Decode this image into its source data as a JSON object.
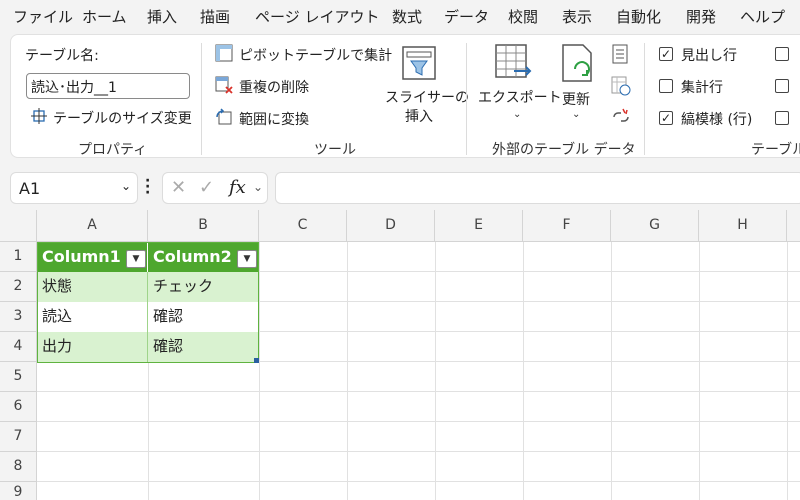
{
  "menu": [
    "ファイル",
    "ホーム",
    "挿入",
    "描画",
    "ページ レイアウト",
    "数式",
    "データ",
    "校閲",
    "表示",
    "自動化",
    "開発",
    "ヘルプ"
  ],
  "ribbon": {
    "properties": {
      "name_label": "テーブル名:",
      "name_value": "読込･出力__1",
      "resize_label": "テーブルのサイズ変更",
      "group_label": "プロパティ"
    },
    "tools": {
      "pivot_label": "ピボットテーブルで集計",
      "dedupe_label": "重複の削除",
      "convert_label": "範囲に変換",
      "slicer_label_1": "スライサーの",
      "slicer_label_2": "挿入",
      "group_label": "ツール"
    },
    "external": {
      "export_label": "エクスポート",
      "refresh_label": "更新",
      "group_label": "外部のテーブル データ"
    },
    "style_options": {
      "header_row": {
        "label": "見出し行",
        "checked": "✓"
      },
      "total_row": {
        "label": "集計行",
        "checked": ""
      },
      "banded_rows": {
        "label": "縞模様 (行)",
        "checked": "✓"
      },
      "group_label": "テーブル"
    }
  },
  "formula_bar": {
    "cell_ref": "A1",
    "fx": "fx",
    "cancel": "✕",
    "enter": "✓",
    "value": ""
  },
  "sheet": {
    "columns": [
      "A",
      "B",
      "C",
      "D",
      "E",
      "F",
      "G",
      "H"
    ],
    "rows": [
      "1",
      "2",
      "3",
      "4",
      "5",
      "6",
      "7",
      "8",
      "9"
    ],
    "table": {
      "headers": [
        "Column1",
        "Column2"
      ],
      "rows": [
        [
          "状態",
          "チェック"
        ],
        [
          "読込",
          "確認"
        ],
        [
          "出力",
          "確認"
        ]
      ]
    }
  },
  "colors": {
    "table_header": "#4ea72e",
    "table_band": "#d9f2d0"
  }
}
